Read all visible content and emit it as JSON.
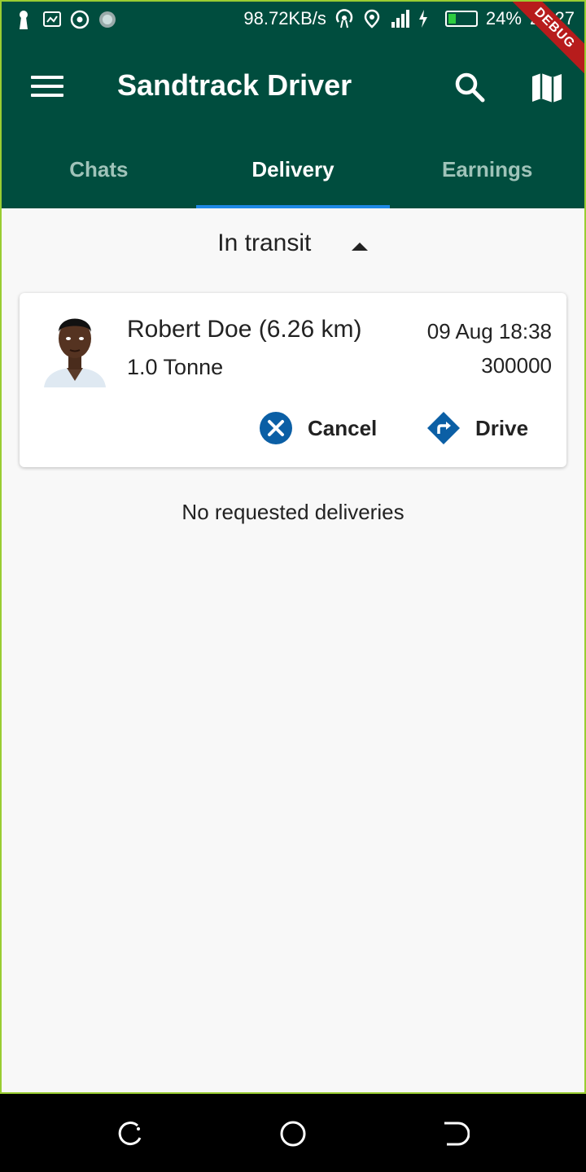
{
  "status_bar": {
    "speed": "98.72KB/s",
    "battery": "24%",
    "time": "23:27"
  },
  "app": {
    "title": "Sandtrack Driver",
    "debug_label": "DEBUG"
  },
  "tabs": [
    {
      "label": "Chats"
    },
    {
      "label": "Delivery"
    },
    {
      "label": "Earnings"
    }
  ],
  "active_tab": "Delivery",
  "in_transit": {
    "label": "In transit"
  },
  "delivery_card": {
    "name": "Robert Doe (6.26 km)",
    "weight": "1.0 Tonne",
    "datetime": "09 Aug 18:38",
    "amount": "300000",
    "cancel_label": "Cancel",
    "drive_label": "Drive"
  },
  "requested": {
    "empty_text": "No requested deliveries"
  },
  "colors": {
    "primary": "#004d3e",
    "tab_indicator": "#1e88e5",
    "action_blue": "#0b5fa5"
  }
}
